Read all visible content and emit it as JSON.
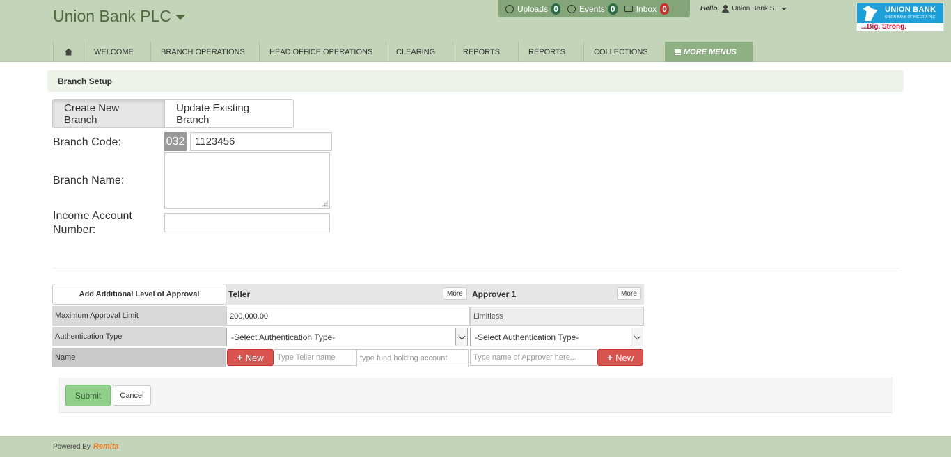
{
  "header": {
    "app_title": "Union Bank PLC",
    "notifications": [
      {
        "label": "Uploads",
        "count": "0",
        "badge_color": "#2c6b46"
      },
      {
        "label": "Events",
        "count": "0",
        "badge_color": "#2c6b46"
      },
      {
        "label": "Inbox",
        "count": "0",
        "badge_color": "#c9302c"
      }
    ],
    "greeting": "Hello,",
    "user_name": "Union Bank S.",
    "logo": {
      "name": "UNION BANK",
      "sub": "UNION BANK OF NIGERIA PLC",
      "tagline": "...Big. Strong."
    }
  },
  "nav": {
    "items": [
      "WELCOME",
      "BRANCH OPERATIONS",
      "HEAD OFFICE OPERATIONS",
      "CLEARING",
      "REPORTS",
      "REPORTS",
      "COLLECTIONS"
    ],
    "more": "MORE MENUS"
  },
  "page": {
    "heading": "Branch Setup",
    "tabs": [
      "Create New Branch",
      "Update Existing Branch"
    ],
    "form": {
      "branch_code_label": "Branch Code:",
      "branch_code_prefix": "032",
      "branch_code_value": "1123456",
      "branch_name_label": "Branch Name:",
      "branch_name_value": "",
      "income_account_label": "Income Account Number:",
      "income_account_value": ""
    }
  },
  "approval": {
    "add_level_label": "Add Additional Level of Approval",
    "rows": [
      "Maximum Approval Limit",
      "Authentication Type",
      "Name"
    ],
    "more_label": "More",
    "new_label": "New",
    "teller": {
      "title": "Teller",
      "limit": "200,000.00",
      "auth_type": "-Select Authentication Type-",
      "name_placeholder": "Type Teller name",
      "account_placeholder": "type fund holding account"
    },
    "approver1": {
      "title": "Approver 1",
      "limit": "Limitless",
      "auth_type": "-Select Authentication Type-",
      "name_placeholder": "Type name of Approver here..."
    }
  },
  "actions": {
    "submit": "Submit",
    "cancel": "Cancel"
  },
  "footer": {
    "powered_by": "Powered By",
    "brand": "Remita"
  }
}
